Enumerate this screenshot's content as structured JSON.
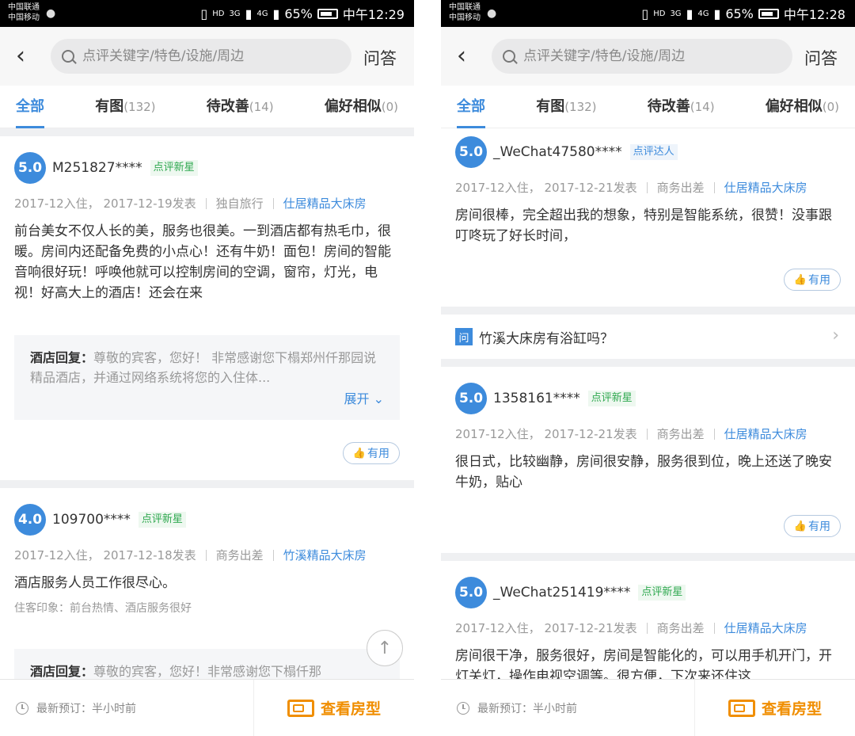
{
  "status_left": {
    "carrier1": "中国联通",
    "carrier2": "中国移动",
    "battery": "65%",
    "time": "中午12:29",
    "hd": "HD",
    "net1": "3G",
    "net2": "4G"
  },
  "status_right": {
    "carrier1": "中国联通",
    "carrier2": "中国移动",
    "battery": "65%",
    "time": "中午12:28",
    "hd": "HD",
    "net1": "3G",
    "net2": "4G"
  },
  "header": {
    "search_placeholder": "点评关键字/特色/设施/周边",
    "qa_label": "问答"
  },
  "tabs": [
    {
      "label": "全部",
      "count": ""
    },
    {
      "label": "有图",
      "count": "(132)"
    },
    {
      "label": "待改善",
      "count": "(14)"
    },
    {
      "label": "偏好相似",
      "count": "(0)"
    }
  ],
  "left_reviews": [
    {
      "score": "5.0",
      "user": "M251827****",
      "badge": "点评新星",
      "stay": "2017-12入住，",
      "posted": "2017-12-19发表",
      "trip": "独自旅行",
      "room": "仕居精品大床房",
      "text": "前台美女不仅人长的美，服务也很美。一到酒店都有热毛巾，很暖。房间内还配备免费的小点心！还有牛奶！面包！房间的智能音响很好玩！呼唤他就可以控制房间的空调，窗帘，灯光，电视！好高大上的酒店！还会在来",
      "reply_label": "酒店回复：",
      "reply_text": "尊敬的宾客，您好！ 非常感谢您下榻郑州仟那园说精品酒店，并通过网络系统将您的入住体...",
      "expand": "展开"
    },
    {
      "score": "4.0",
      "user": "109700****",
      "badge": "点评新星",
      "stay": "2017-12入住，",
      "posted": "2017-12-18发表",
      "trip": "商务出差",
      "room": "竹溪精品大床房",
      "text": "酒店服务人员工作很尽心。",
      "impression": "住客印象：前台热情、酒店服务很好",
      "reply_label": "酒店回复：",
      "reply_text": "尊敬的宾客，您好！非常感谢您下榻仟那"
    }
  ],
  "right_reviews": [
    {
      "score": "5.0",
      "user": "_WeChat47580****",
      "badge": "点评达人",
      "stay": "2017-12入住，",
      "posted": "2017-12-21发表",
      "trip": "商务出差",
      "room": "仕居精品大床房",
      "text": "房间很棒，完全超出我的想象，特别是智能系统，很赞！没事跟叮咚玩了好长时间，"
    },
    {
      "score": "5.0",
      "user": "1358161****",
      "badge": "点评新星",
      "stay": "2017-12入住，",
      "posted": "2017-12-21发表",
      "trip": "商务出差",
      "room": "仕居精品大床房",
      "text": "很日式，比较幽静，房间很安静，服务很到位，晚上还送了晚安牛奶，贴心"
    },
    {
      "score": "5.0",
      "user": "_WeChat251419****",
      "badge": "点评新星",
      "stay": "2017-12入住，",
      "posted": "2017-12-21发表",
      "trip": "商务出差",
      "room": "仕居精品大床房",
      "text": "房间很干净，服务很好，房间是智能化的，可以用手机开门，开灯关灯，操作电视空调等。很方便，下次来还住这"
    }
  ],
  "qa": {
    "icon": "问",
    "question": "竹溪大床房有浴缸吗？"
  },
  "useful_label": "有用",
  "bottom": {
    "latest": "最新预订：半小时前",
    "view_rooms": "查看房型"
  },
  "colors": {
    "accent": "#3d8bdc",
    "orange": "#f08e00",
    "green_badge": "#2fa84f"
  }
}
